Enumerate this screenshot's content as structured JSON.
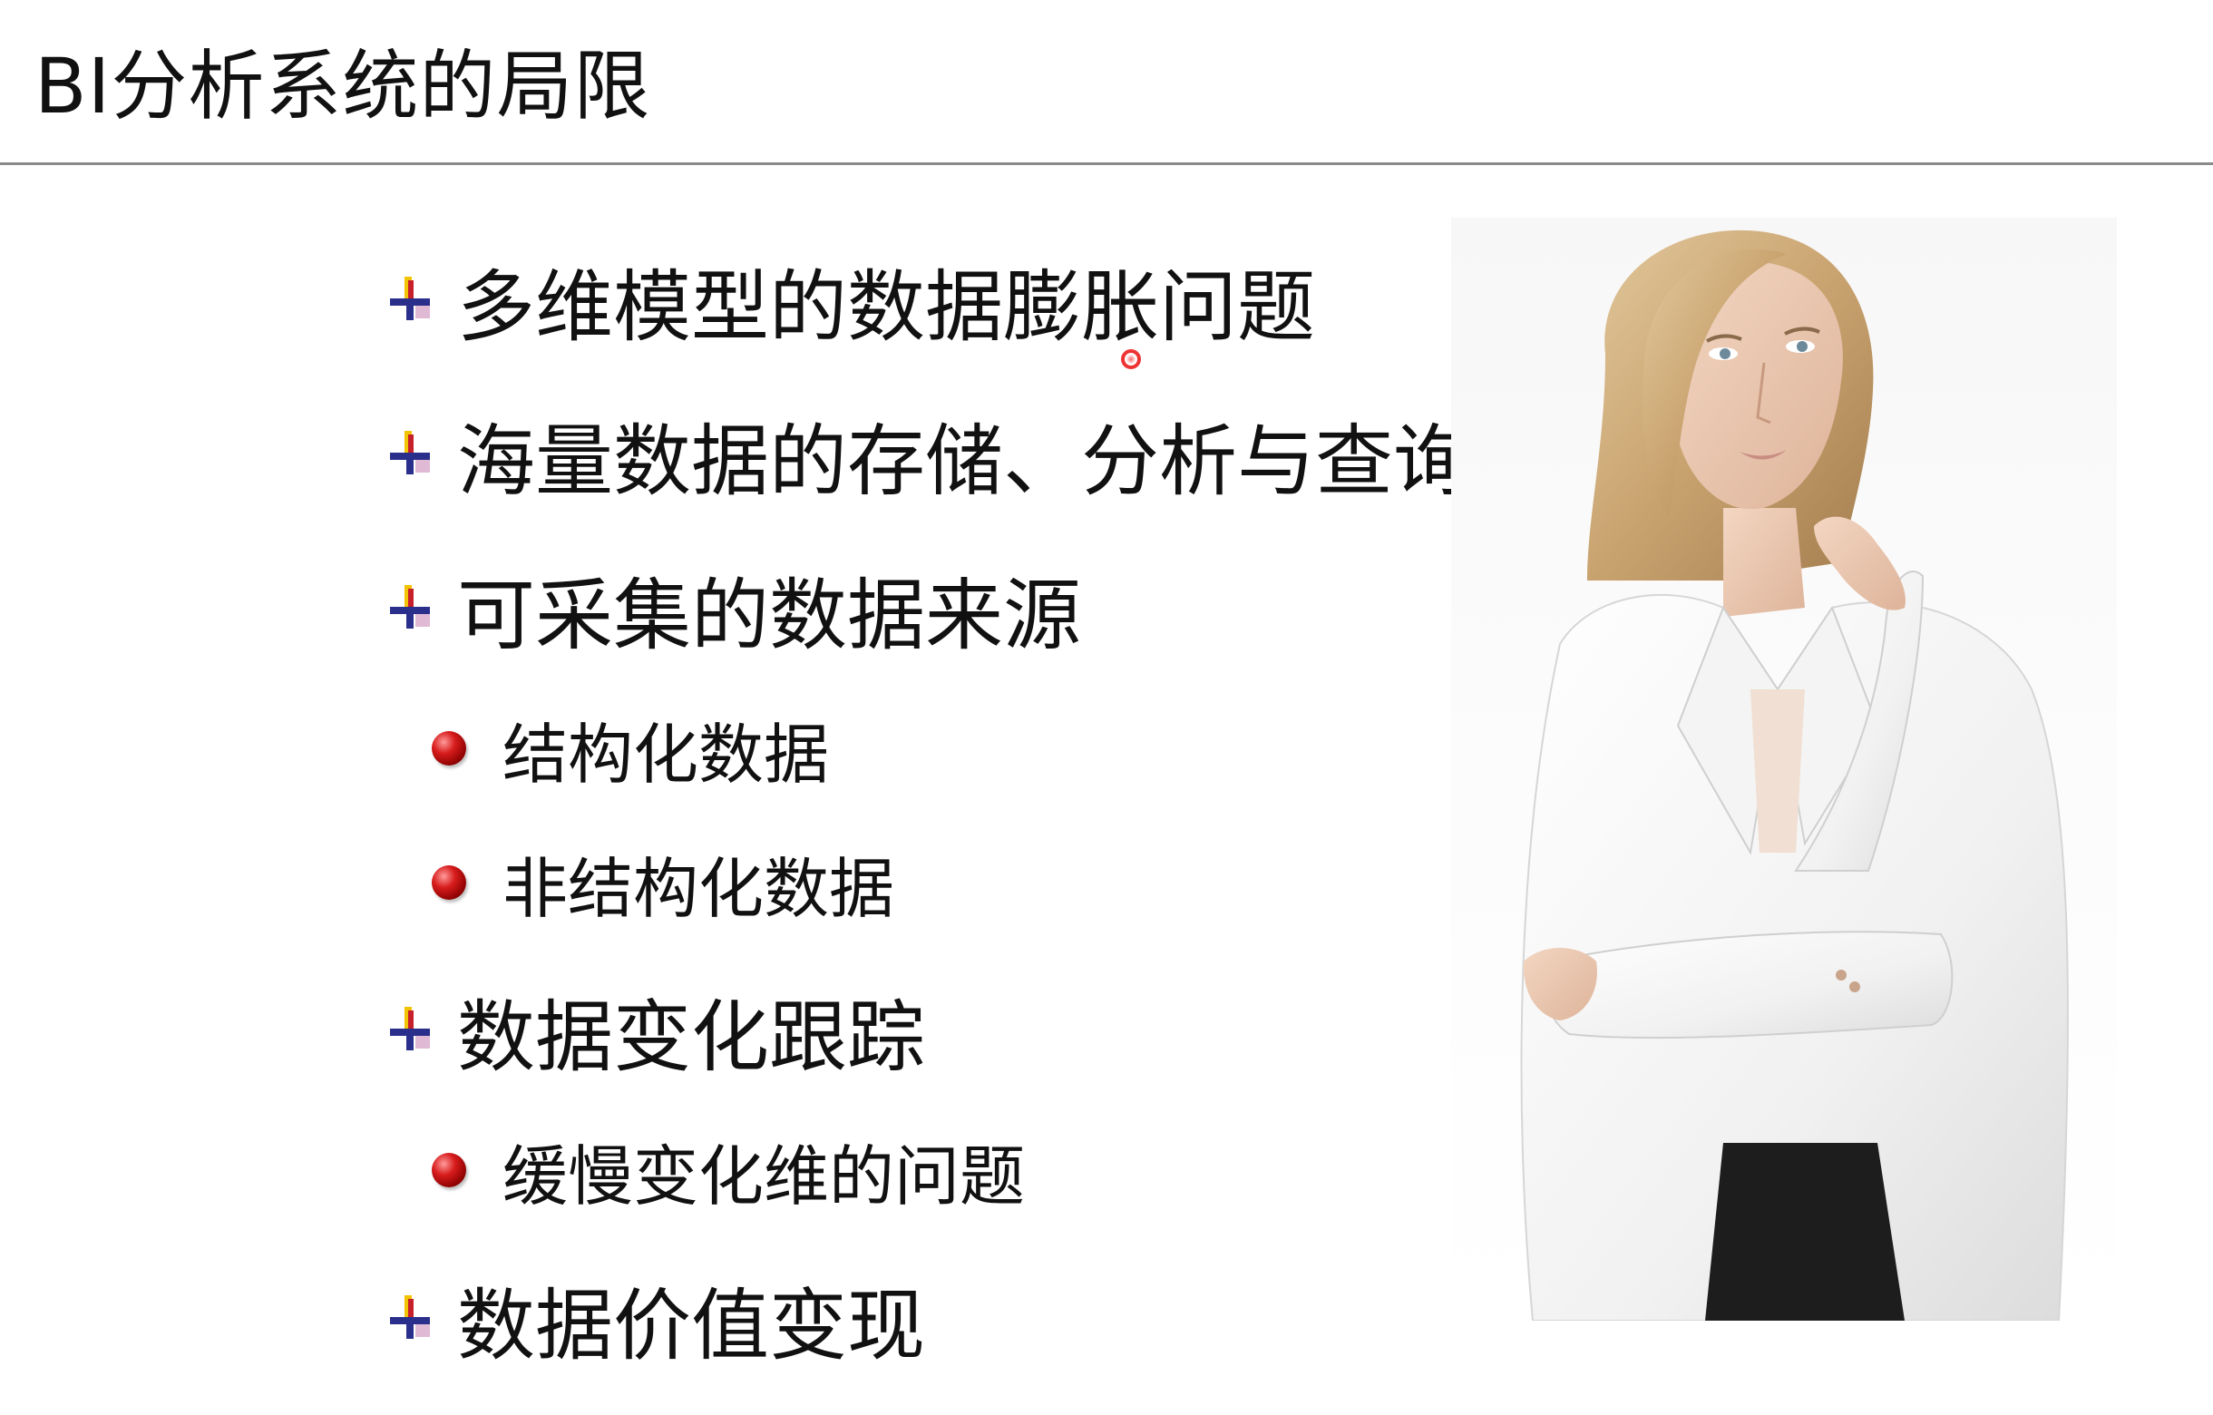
{
  "slide": {
    "title": "BI分析系统的局限"
  },
  "bullets": [
    {
      "level": 1,
      "text": "多维模型的数据膨胀问题"
    },
    {
      "level": 1,
      "text": "海量数据的存储、分析与查询"
    },
    {
      "level": 1,
      "text": "可采集的数据来源"
    },
    {
      "level": 2,
      "text": "结构化数据"
    },
    {
      "level": 2,
      "text": "非结构化数据"
    },
    {
      "level": 1,
      "text": "数据变化跟踪"
    },
    {
      "level": 2,
      "text": "缓慢变化维的问题"
    },
    {
      "level": 1,
      "text": "数据价值变现"
    }
  ],
  "icons": {
    "level1_bullet": "plus-cross-icon",
    "level2_bullet": "red-sphere-icon",
    "pointer": "laser-pointer-icon"
  },
  "colors": {
    "text": "#111111",
    "title_rule": "#8a8a8a",
    "bullet_red": "#c8202a",
    "bullet_blue": "#2a2f8c",
    "bullet_yellow": "#f2c300"
  }
}
